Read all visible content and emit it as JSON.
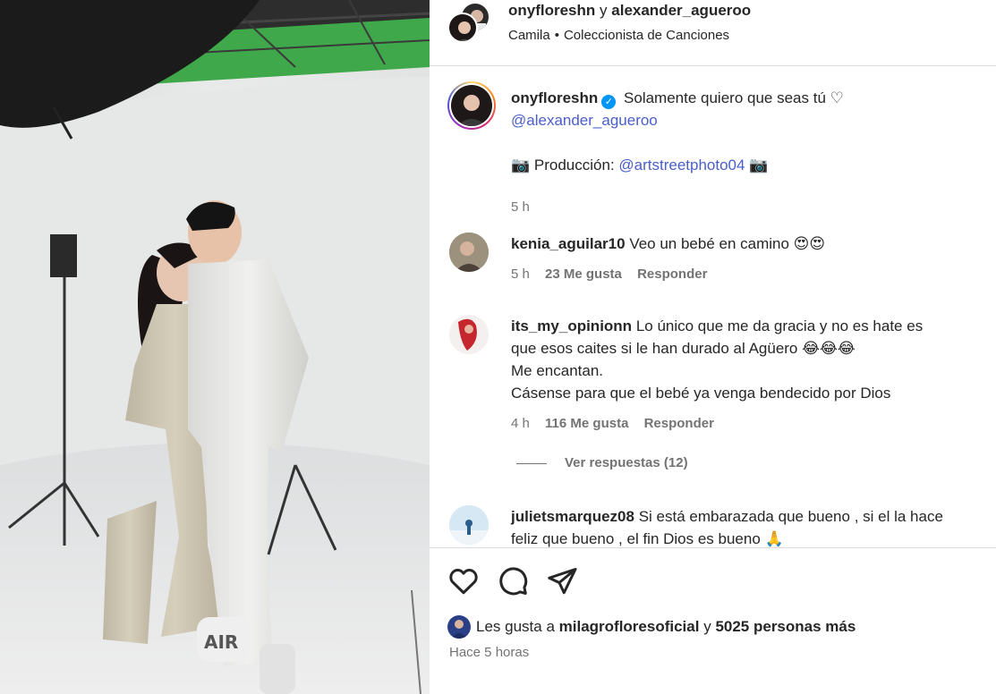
{
  "header": {
    "title_user1": "onyfloreshn",
    "title_and": "y",
    "title_user2": "alexander_agueroo",
    "sub_artist": "Camila",
    "sub_dot": "•",
    "sub_song": "Coleccionista de Canciones"
  },
  "caption": {
    "username": "onyfloreshn",
    "verified": "✓",
    "text": "Solamente quiero que seas tú ♡",
    "mention": "@alexander_agueroo",
    "production_label": "📷 Producción:",
    "production_mention": "@artstreetphoto04",
    "production_emoji": "📷",
    "time": "5 h"
  },
  "comments": [
    {
      "username": "kenia_aguilar10",
      "lines": [
        "Veo un bebé en camino 😍😍"
      ],
      "time": "5 h",
      "likes": "23 Me gusta",
      "reply": "Responder"
    },
    {
      "username": "its_my_opinionn",
      "lines": [
        "Lo único que me da gracia y no es hate es",
        "que esos caites si le han durado al Agüero 😂😂😂",
        "Me encantan.",
        "Cásense para que el bebé ya venga bendecido por Dios"
      ],
      "time": "4 h",
      "likes": "116 Me gusta",
      "reply": "Responder",
      "view_replies": "Ver respuestas (12)"
    },
    {
      "username": "julietsmarquez08",
      "lines": [
        "Si está embarazada que bueno , si el la hace",
        "feliz que bueno , el fin Dios es bueno 🙏"
      ]
    }
  ],
  "actions": {
    "like_icon": "heart-icon",
    "comment_icon": "comment-icon",
    "share_icon": "send-icon"
  },
  "likes": {
    "prefix": "Les gusta a",
    "user": "milagrofloresoficial",
    "connector": "y",
    "others": "5025 personas más"
  },
  "posted": "Hace 5 horas",
  "colors": {
    "mention": "#4a5ec9",
    "verified": "#0095f6",
    "muted": "#737373",
    "divider": "#dbdbdb"
  }
}
